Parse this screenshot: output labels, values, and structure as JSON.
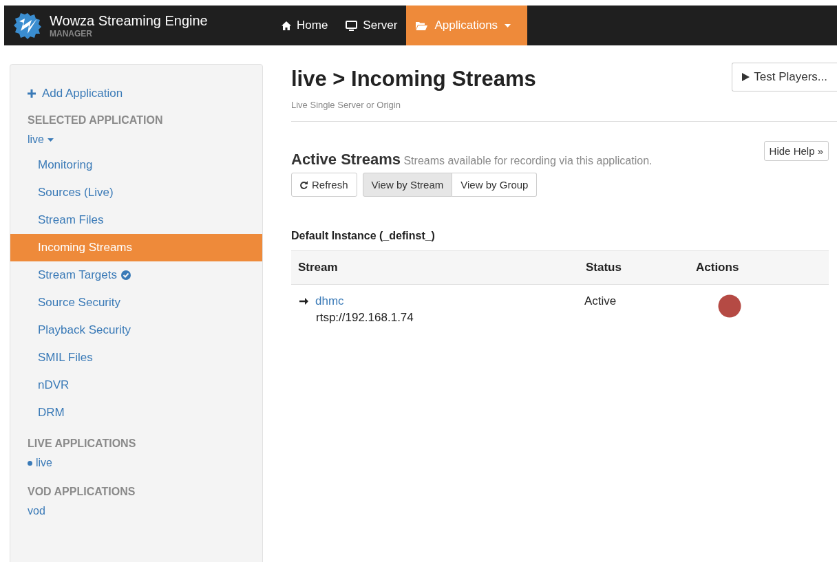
{
  "brand": {
    "title": "Wowza Streaming Engine",
    "subtitle": "MANAGER"
  },
  "nav": [
    {
      "label": "Home",
      "kind": "home",
      "selected": false
    },
    {
      "label": "Server",
      "kind": "server",
      "selected": false
    },
    {
      "label": "Applications",
      "kind": "applications",
      "selected": true
    }
  ],
  "sidebar": {
    "items": [
      {
        "kind": "add",
        "label": "Add Application"
      },
      {
        "kind": "header",
        "label": "SELECTED APPLICATION"
      },
      {
        "kind": "app-menu",
        "label": "live"
      },
      {
        "kind": "sub",
        "label": "Monitoring",
        "selected": false,
        "checked": false
      },
      {
        "kind": "sub",
        "label": "Sources (Live)",
        "selected": false,
        "checked": false
      },
      {
        "kind": "sub",
        "label": "Stream Files",
        "selected": false,
        "checked": false
      },
      {
        "kind": "sub",
        "label": "Incoming Streams",
        "selected": true,
        "checked": false
      },
      {
        "kind": "sub",
        "label": "Stream Targets",
        "selected": false,
        "checked": true
      },
      {
        "kind": "sub",
        "label": "Source Security",
        "selected": false,
        "checked": false
      },
      {
        "kind": "sub",
        "label": "Playback Security",
        "selected": false,
        "checked": false
      },
      {
        "kind": "sub",
        "label": "SMIL Files",
        "selected": false,
        "checked": false
      },
      {
        "kind": "sub",
        "label": "nDVR",
        "selected": false,
        "checked": false
      },
      {
        "kind": "sub",
        "label": "DRM",
        "selected": false,
        "checked": false
      },
      {
        "kind": "header",
        "label": "LIVE APPLICATIONS"
      },
      {
        "kind": "running-app",
        "label": "live"
      },
      {
        "kind": "header",
        "label": "VOD APPLICATIONS"
      },
      {
        "kind": "app",
        "label": "vod"
      }
    ]
  },
  "page": {
    "title": "live > Incoming Streams",
    "subtitle": "Live Single Server or Origin",
    "test_button": "Test Players..."
  },
  "section": {
    "title": "Active Streams",
    "description": "Streams available for recording via this application.",
    "help_button": "Hide Help »",
    "refresh_button": "Refresh",
    "view_buttons": [
      {
        "label": "View by Stream",
        "selected": true
      },
      {
        "label": "View by Group",
        "selected": false
      }
    ]
  },
  "instance": {
    "title": "Default Instance (_definst_)",
    "columns": [
      "Stream",
      "Status",
      "Actions"
    ],
    "rows": [
      {
        "stream": "dhmc",
        "url": "rtsp://192.168.1.74",
        "status": "Active"
      }
    ]
  }
}
